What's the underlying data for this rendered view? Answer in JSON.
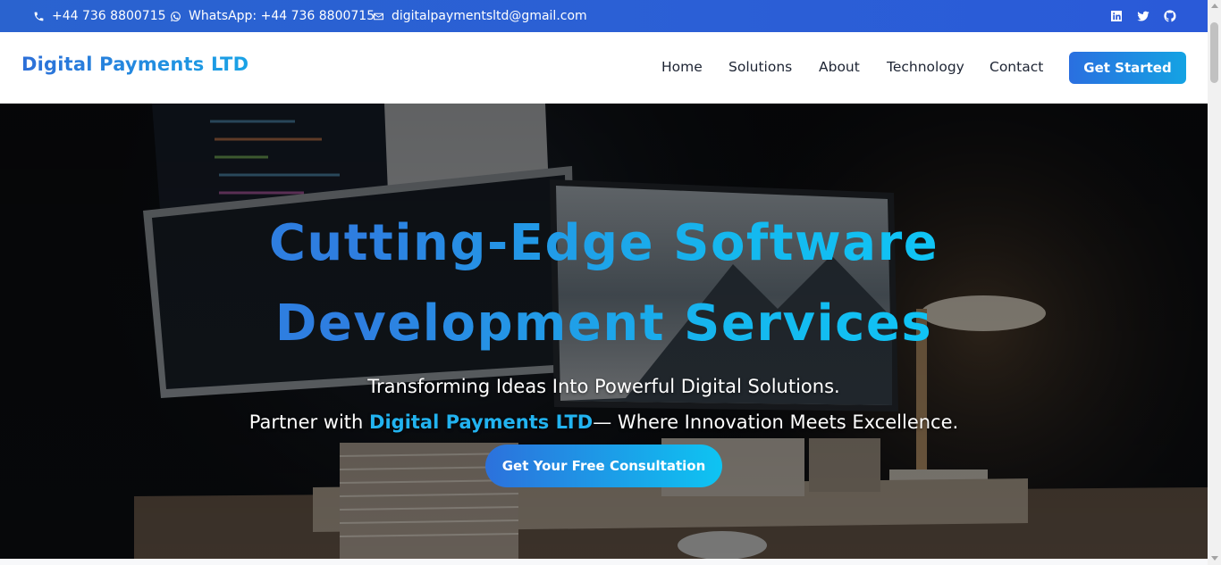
{
  "topbar": {
    "phone": "+44 736 8800715",
    "whatsapp": "WhatsApp: +44 736 8800715",
    "email": "digitalpaymentsltd@gmail.com",
    "social": [
      "linkedin-icon",
      "twitter-icon",
      "github-icon"
    ]
  },
  "navbar": {
    "brand": "Digital Payments LTD",
    "links": [
      "Home",
      "Solutions",
      "About",
      "Technology",
      "Contact"
    ],
    "cta": "Get Started"
  },
  "hero": {
    "headline_line1": "Cutting-Edge Software",
    "headline_line2": "Development Services",
    "subtitle_line1": "Transforming Ideas Into Powerful Digital Solutions.",
    "subtitle_line2_prefix": "Partner with ",
    "subtitle_line2_brand": "Digital Payments LTD",
    "subtitle_line2_suffix": "— Where Innovation Meets Excellence.",
    "cta": "Get Your Free Consultation"
  },
  "colors": {
    "topbar": "#2b5fd6",
    "accent": "#1aa3e6",
    "button_gradient_start": "#2a6fe0",
    "button_gradient_end": "#0ec4f2"
  }
}
